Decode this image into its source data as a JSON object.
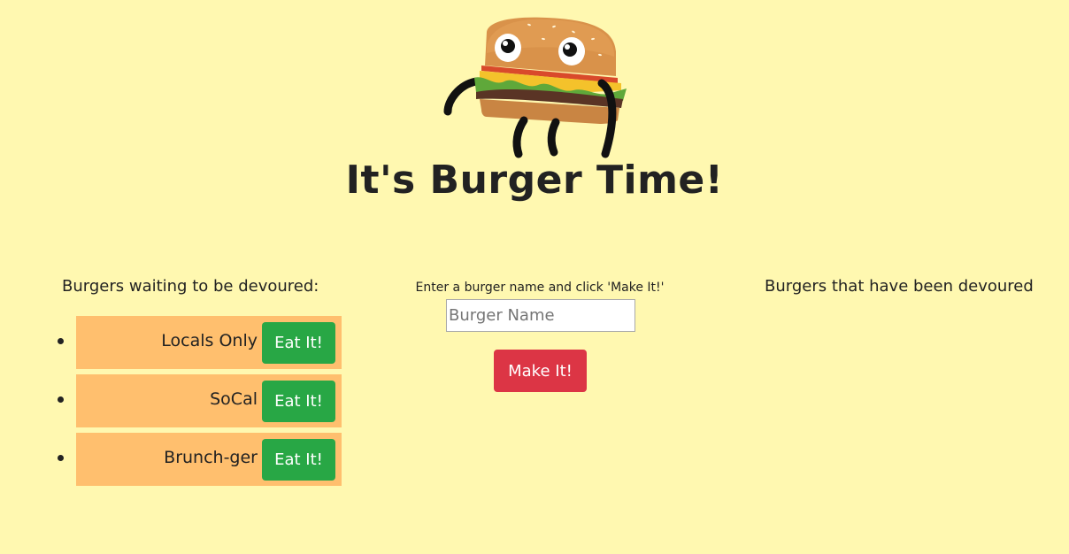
{
  "logo": {
    "icon": "burger-mascot-icon"
  },
  "header": {
    "title": "It's Burger Time!"
  },
  "waiting": {
    "heading": "Burgers waiting to be devoured:",
    "items": [
      {
        "name": "Locals Only",
        "button_label": "Eat It!"
      },
      {
        "name": "SoCal",
        "button_label": "Eat It!"
      },
      {
        "name": "Brunch-ger",
        "button_label": "Eat It!"
      }
    ]
  },
  "form": {
    "prompt": "Enter a burger name and click 'Make It!'",
    "input_value": "",
    "input_placeholder": "Burger Name",
    "submit_label": "Make It!"
  },
  "devoured": {
    "heading": "Burgers that have been devoured",
    "items": []
  },
  "colors": {
    "background": "#fff8b0",
    "item_background": "#ffbf6e",
    "eat_button": "#28a745",
    "make_button": "#dc3545"
  }
}
